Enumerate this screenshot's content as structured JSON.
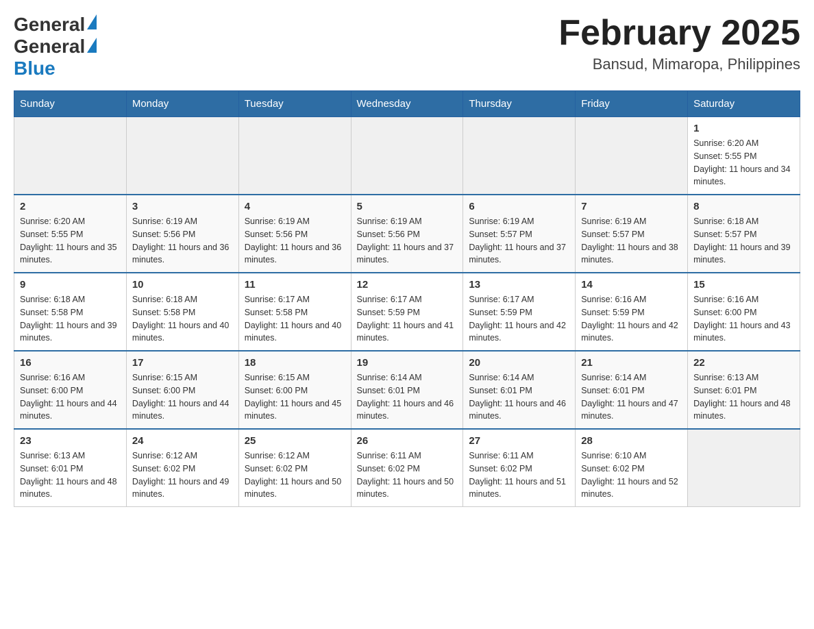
{
  "logo": {
    "general": "General",
    "blue": "Blue"
  },
  "title": "February 2025",
  "location": "Bansud, Mimaropa, Philippines",
  "days_of_week": [
    "Sunday",
    "Monday",
    "Tuesday",
    "Wednesday",
    "Thursday",
    "Friday",
    "Saturday"
  ],
  "weeks": [
    {
      "days": [
        {
          "num": "",
          "sunrise": "",
          "sunset": "",
          "daylight": "",
          "empty": true
        },
        {
          "num": "",
          "sunrise": "",
          "sunset": "",
          "daylight": "",
          "empty": true
        },
        {
          "num": "",
          "sunrise": "",
          "sunset": "",
          "daylight": "",
          "empty": true
        },
        {
          "num": "",
          "sunrise": "",
          "sunset": "",
          "daylight": "",
          "empty": true
        },
        {
          "num": "",
          "sunrise": "",
          "sunset": "",
          "daylight": "",
          "empty": true
        },
        {
          "num": "",
          "sunrise": "",
          "sunset": "",
          "daylight": "",
          "empty": true
        },
        {
          "num": "1",
          "sunrise": "Sunrise: 6:20 AM",
          "sunset": "Sunset: 5:55 PM",
          "daylight": "Daylight: 11 hours and 34 minutes.",
          "empty": false
        }
      ]
    },
    {
      "days": [
        {
          "num": "2",
          "sunrise": "Sunrise: 6:20 AM",
          "sunset": "Sunset: 5:55 PM",
          "daylight": "Daylight: 11 hours and 35 minutes.",
          "empty": false
        },
        {
          "num": "3",
          "sunrise": "Sunrise: 6:19 AM",
          "sunset": "Sunset: 5:56 PM",
          "daylight": "Daylight: 11 hours and 36 minutes.",
          "empty": false
        },
        {
          "num": "4",
          "sunrise": "Sunrise: 6:19 AM",
          "sunset": "Sunset: 5:56 PM",
          "daylight": "Daylight: 11 hours and 36 minutes.",
          "empty": false
        },
        {
          "num": "5",
          "sunrise": "Sunrise: 6:19 AM",
          "sunset": "Sunset: 5:56 PM",
          "daylight": "Daylight: 11 hours and 37 minutes.",
          "empty": false
        },
        {
          "num": "6",
          "sunrise": "Sunrise: 6:19 AM",
          "sunset": "Sunset: 5:57 PM",
          "daylight": "Daylight: 11 hours and 37 minutes.",
          "empty": false
        },
        {
          "num": "7",
          "sunrise": "Sunrise: 6:19 AM",
          "sunset": "Sunset: 5:57 PM",
          "daylight": "Daylight: 11 hours and 38 minutes.",
          "empty": false
        },
        {
          "num": "8",
          "sunrise": "Sunrise: 6:18 AM",
          "sunset": "Sunset: 5:57 PM",
          "daylight": "Daylight: 11 hours and 39 minutes.",
          "empty": false
        }
      ]
    },
    {
      "days": [
        {
          "num": "9",
          "sunrise": "Sunrise: 6:18 AM",
          "sunset": "Sunset: 5:58 PM",
          "daylight": "Daylight: 11 hours and 39 minutes.",
          "empty": false
        },
        {
          "num": "10",
          "sunrise": "Sunrise: 6:18 AM",
          "sunset": "Sunset: 5:58 PM",
          "daylight": "Daylight: 11 hours and 40 minutes.",
          "empty": false
        },
        {
          "num": "11",
          "sunrise": "Sunrise: 6:17 AM",
          "sunset": "Sunset: 5:58 PM",
          "daylight": "Daylight: 11 hours and 40 minutes.",
          "empty": false
        },
        {
          "num": "12",
          "sunrise": "Sunrise: 6:17 AM",
          "sunset": "Sunset: 5:59 PM",
          "daylight": "Daylight: 11 hours and 41 minutes.",
          "empty": false
        },
        {
          "num": "13",
          "sunrise": "Sunrise: 6:17 AM",
          "sunset": "Sunset: 5:59 PM",
          "daylight": "Daylight: 11 hours and 42 minutes.",
          "empty": false
        },
        {
          "num": "14",
          "sunrise": "Sunrise: 6:16 AM",
          "sunset": "Sunset: 5:59 PM",
          "daylight": "Daylight: 11 hours and 42 minutes.",
          "empty": false
        },
        {
          "num": "15",
          "sunrise": "Sunrise: 6:16 AM",
          "sunset": "Sunset: 6:00 PM",
          "daylight": "Daylight: 11 hours and 43 minutes.",
          "empty": false
        }
      ]
    },
    {
      "days": [
        {
          "num": "16",
          "sunrise": "Sunrise: 6:16 AM",
          "sunset": "Sunset: 6:00 PM",
          "daylight": "Daylight: 11 hours and 44 minutes.",
          "empty": false
        },
        {
          "num": "17",
          "sunrise": "Sunrise: 6:15 AM",
          "sunset": "Sunset: 6:00 PM",
          "daylight": "Daylight: 11 hours and 44 minutes.",
          "empty": false
        },
        {
          "num": "18",
          "sunrise": "Sunrise: 6:15 AM",
          "sunset": "Sunset: 6:00 PM",
          "daylight": "Daylight: 11 hours and 45 minutes.",
          "empty": false
        },
        {
          "num": "19",
          "sunrise": "Sunrise: 6:14 AM",
          "sunset": "Sunset: 6:01 PM",
          "daylight": "Daylight: 11 hours and 46 minutes.",
          "empty": false
        },
        {
          "num": "20",
          "sunrise": "Sunrise: 6:14 AM",
          "sunset": "Sunset: 6:01 PM",
          "daylight": "Daylight: 11 hours and 46 minutes.",
          "empty": false
        },
        {
          "num": "21",
          "sunrise": "Sunrise: 6:14 AM",
          "sunset": "Sunset: 6:01 PM",
          "daylight": "Daylight: 11 hours and 47 minutes.",
          "empty": false
        },
        {
          "num": "22",
          "sunrise": "Sunrise: 6:13 AM",
          "sunset": "Sunset: 6:01 PM",
          "daylight": "Daylight: 11 hours and 48 minutes.",
          "empty": false
        }
      ]
    },
    {
      "days": [
        {
          "num": "23",
          "sunrise": "Sunrise: 6:13 AM",
          "sunset": "Sunset: 6:01 PM",
          "daylight": "Daylight: 11 hours and 48 minutes.",
          "empty": false
        },
        {
          "num": "24",
          "sunrise": "Sunrise: 6:12 AM",
          "sunset": "Sunset: 6:02 PM",
          "daylight": "Daylight: 11 hours and 49 minutes.",
          "empty": false
        },
        {
          "num": "25",
          "sunrise": "Sunrise: 6:12 AM",
          "sunset": "Sunset: 6:02 PM",
          "daylight": "Daylight: 11 hours and 50 minutes.",
          "empty": false
        },
        {
          "num": "26",
          "sunrise": "Sunrise: 6:11 AM",
          "sunset": "Sunset: 6:02 PM",
          "daylight": "Daylight: 11 hours and 50 minutes.",
          "empty": false
        },
        {
          "num": "27",
          "sunrise": "Sunrise: 6:11 AM",
          "sunset": "Sunset: 6:02 PM",
          "daylight": "Daylight: 11 hours and 51 minutes.",
          "empty": false
        },
        {
          "num": "28",
          "sunrise": "Sunrise: 6:10 AM",
          "sunset": "Sunset: 6:02 PM",
          "daylight": "Daylight: 11 hours and 52 minutes.",
          "empty": false
        },
        {
          "num": "",
          "sunrise": "",
          "sunset": "",
          "daylight": "",
          "empty": true
        }
      ]
    }
  ]
}
